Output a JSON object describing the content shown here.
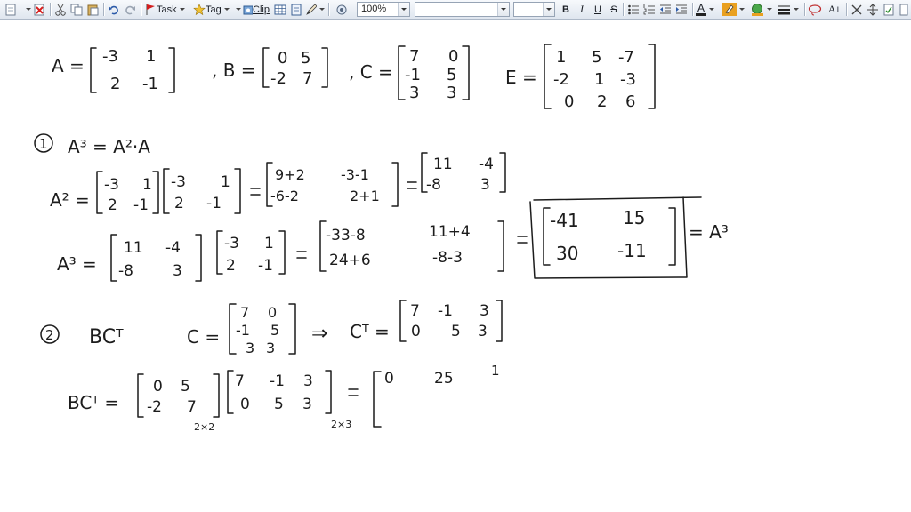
{
  "toolbar": {
    "task_label": "Task",
    "tag_label": "Tag",
    "clip_label": "Clip",
    "zoom_value": "100%",
    "font_name_value": "",
    "font_size_value": "",
    "bold_label": "B",
    "italic_label": "I",
    "underline_label": "U",
    "strike_label": "S",
    "font_color_letter": "A",
    "text_effects_label": "A",
    "accent_color": "#f0a020",
    "highlight_color": "#e9a020",
    "icons": [
      "new-note-icon",
      "delete-icon",
      "cut-icon",
      "copy-icon",
      "paste-icon",
      "undo-icon",
      "redo-icon",
      "task-flag-icon",
      "tag-star-icon",
      "clip-icon",
      "table-icon",
      "page-icon",
      "pen-icon",
      "stamp-icon",
      "bullets-icon",
      "numbering-icon",
      "outdent-icon",
      "indent-icon",
      "eraser-icon",
      "spacing-icon",
      "fill-icon",
      "line-style-icon",
      "lasso-icon",
      "close-icon",
      "spell-icon"
    ]
  },
  "note": {
    "given": {
      "A_label": "A =",
      "A_rows": [
        [
          "-3",
          "1"
        ],
        [
          "2",
          "-1"
        ]
      ],
      "B_label": ", B =",
      "B_rows": [
        [
          "0",
          "5"
        ],
        [
          "-2",
          "7"
        ]
      ],
      "C_label": ", C =",
      "C_rows": [
        [
          "7",
          "0"
        ],
        [
          "-1",
          "5"
        ],
        [
          "3",
          "3"
        ]
      ],
      "E_label": "E =",
      "E_rows": [
        [
          "1",
          "5",
          "-7"
        ],
        [
          "-2",
          "1",
          "-3"
        ],
        [
          "0",
          "2",
          "6"
        ]
      ]
    },
    "part1": {
      "marker": "1",
      "heading": "A³ = A²·A",
      "a2_label": "A² =",
      "a2_factor1": [
        [
          "-3",
          "1"
        ],
        [
          "2",
          "-1"
        ]
      ],
      "a2_factor2": [
        [
          "-3",
          "1"
        ],
        [
          "2",
          "-1"
        ]
      ],
      "a2_expand": [
        [
          "9+2",
          "-3-1"
        ],
        [
          "-6-2",
          "2+1"
        ]
      ],
      "a2_result": [
        [
          "11",
          "-4"
        ],
        [
          "-8",
          "3"
        ]
      ],
      "a3_label": "A³ =",
      "a3_factor1": [
        [
          "11",
          "-4"
        ],
        [
          "-8",
          "3"
        ]
      ],
      "a3_factor2": [
        [
          "-3",
          "1"
        ],
        [
          "2",
          "-1"
        ]
      ],
      "a3_expand": [
        [
          "-33-8",
          "11+4"
        ],
        [
          "24+6",
          "-8-3"
        ]
      ],
      "a3_result": [
        [
          "-41",
          "15"
        ],
        [
          "30",
          "-11"
        ]
      ],
      "a3_tail": "= A³"
    },
    "part2": {
      "marker": "2",
      "heading": "BCᵀ",
      "c_label": "C =",
      "c_rows": [
        [
          "7",
          "0"
        ],
        [
          "-1",
          "5"
        ],
        [
          "3",
          "3"
        ]
      ],
      "implies": "⇒",
      "ct_label": "Cᵀ =",
      "ct_rows": [
        [
          "7",
          "-1",
          "3"
        ],
        [
          "0",
          "5",
          "3"
        ]
      ],
      "bct_label": "BCᵀ =",
      "b_rows": [
        [
          "0",
          "5"
        ],
        [
          "-2",
          "7"
        ]
      ],
      "b_dim": "2×2",
      "ct_dim": "2×3",
      "partial_result": [
        "0",
        "25",
        "1"
      ]
    }
  }
}
